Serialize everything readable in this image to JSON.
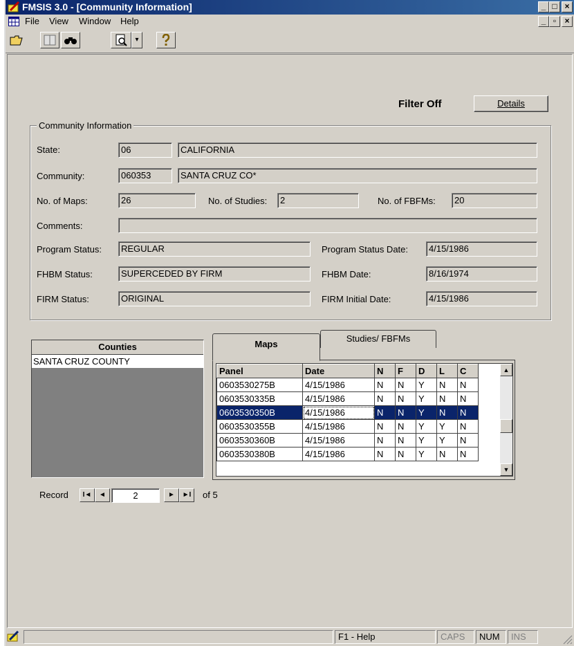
{
  "window": {
    "title": "FMSIS 3.0 - [Community Information]",
    "buttons": {
      "minimize": "_",
      "maximize": "□",
      "close": "×"
    },
    "inner_buttons": {
      "minimize": "_",
      "restore": "▫",
      "close": "×"
    }
  },
  "menu": [
    "File",
    "View",
    "Window",
    "Help"
  ],
  "toolbar": {
    "dropdown_arrow": "▾"
  },
  "filter": {
    "label": "Filter Off",
    "details_button": "Details"
  },
  "community": {
    "group_label": "Community Information",
    "state_label": "State:",
    "state_code": "06",
    "state_name": "CALIFORNIA",
    "community_label": "Community:",
    "community_code": "060353",
    "community_name": "SANTA CRUZ CO*",
    "maps_label": "No. of Maps:",
    "maps_value": "26",
    "studies_label": "No. of Studies:",
    "studies_value": "2",
    "fbfms_label": "No. of FBFMs:",
    "fbfms_value": "20",
    "comments_label": "Comments:",
    "comments_value": "",
    "program_status_label": "Program Status:",
    "program_status_value": "REGULAR",
    "program_status_date_label": "Program Status Date:",
    "program_status_date_value": "4/15/1986",
    "fhbm_status_label": "FHBM Status:",
    "fhbm_status_value": "SUPERCEDED BY FIRM",
    "fhbm_date_label": "FHBM Date:",
    "fhbm_date_value": "8/16/1974",
    "firm_status_label": "FIRM Status:",
    "firm_status_value": "ORIGINAL",
    "firm_initial_date_label": "FIRM Initial Date:",
    "firm_initial_date_value": "4/15/1986"
  },
  "counties": {
    "header": "Counties",
    "items": [
      "SANTA CRUZ COUNTY"
    ]
  },
  "tabs": {
    "maps": "Maps",
    "studies": "Studies/ FBFMs"
  },
  "grid": {
    "columns": [
      "Panel",
      "Date",
      "N",
      "F",
      "D",
      "L",
      "C"
    ],
    "rows": [
      [
        "0603530275B",
        "4/15/1986",
        "N",
        "N",
        "Y",
        "N",
        "N"
      ],
      [
        "0603530335B",
        "4/15/1986",
        "N",
        "N",
        "Y",
        "N",
        "N"
      ],
      [
        "0603530350B",
        "4/15/1986",
        "N",
        "N",
        "Y",
        "N",
        "N"
      ],
      [
        "0603530355B",
        "4/15/1986",
        "N",
        "N",
        "Y",
        "Y",
        "N"
      ],
      [
        "0603530360B",
        "4/15/1986",
        "N",
        "N",
        "Y",
        "Y",
        "N"
      ],
      [
        "0603530380B",
        "4/15/1986",
        "N",
        "N",
        "Y",
        "N",
        "N"
      ]
    ],
    "selected_row": 2,
    "scroll_up": "▲",
    "scroll_down": "▼"
  },
  "navigator": {
    "label": "Record",
    "current": "2",
    "of_text": "of 5",
    "first": "I◄",
    "prev": "◄",
    "next": "►",
    "last": "►I"
  },
  "statusbar": {
    "help": "F1 - Help",
    "caps": "CAPS",
    "num": "NUM",
    "ins": "INS"
  },
  "colors": {
    "titlebar": "#0a246a",
    "selection": "#0a246a",
    "face": "#d4d0c8"
  }
}
